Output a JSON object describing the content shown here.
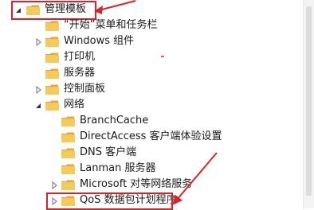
{
  "tree": {
    "items": [
      {
        "label": "管理模板",
        "expanded": true,
        "selected": true
      },
      {
        "label": "“开始”菜单和任务栏"
      },
      {
        "label": "Windows 组件",
        "expanded": false
      },
      {
        "label": "打印机"
      },
      {
        "label": "服务器"
      },
      {
        "label": "控制面板",
        "expanded": false
      },
      {
        "label": "网络",
        "expanded": true
      },
      {
        "label": "BranchCache"
      },
      {
        "label": "DirectAccess 客户端体验设置"
      },
      {
        "label": "DNS 客户端"
      },
      {
        "label": "Lanman 服务器"
      },
      {
        "label": "Microsoft 对等网络服务",
        "expanded": false
      },
      {
        "label": "QoS 数据包计划程序",
        "expanded": false
      }
    ]
  },
  "colors": {
    "annotation_red": "#d9232a",
    "folder_fill": "#f4c95d",
    "folder_dark": "#e0aa3a"
  },
  "icons": {
    "expanded": "triangle-down-icon",
    "collapsed": "triangle-right-icon",
    "folder": "folder-icon"
  }
}
